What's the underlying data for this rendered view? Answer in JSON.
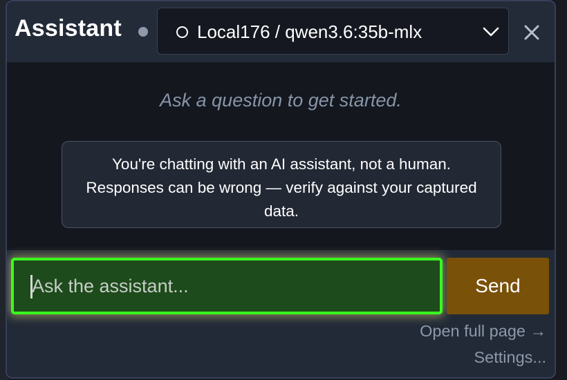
{
  "header": {
    "title": "Assistant",
    "model_select": {
      "selected": "Local176 / qwen3.6:35b-mlx"
    }
  },
  "chat": {
    "empty_hint": "Ask a question to get started.",
    "disclaimer": "You're chatting with an AI assistant, not a human. Responses can be wrong — verify against your captured data."
  },
  "composer": {
    "placeholder": "Ask the assistant...",
    "send_label": "Send"
  },
  "footer": {
    "open_full_page": "Open full page →",
    "settings": "Settings..."
  },
  "colors": {
    "input_border": "#39ff1f",
    "input_bg": "#1e4b1b",
    "send_bg": "#7a5109",
    "status_dot": "#8e9aab"
  },
  "icons": [
    "status-dot-icon",
    "ring-icon",
    "chevron-down-icon",
    "close-icon"
  ]
}
